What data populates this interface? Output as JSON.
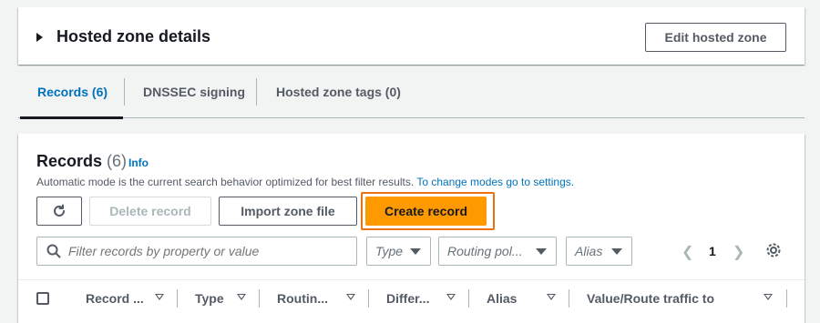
{
  "details": {
    "title": "Hosted zone details",
    "edit_label": "Edit hosted zone"
  },
  "tabs": [
    {
      "label": "Records (6)",
      "active": true
    },
    {
      "label": "DNSSEC signing",
      "active": false
    },
    {
      "label": "Hosted zone tags (0)",
      "active": false
    }
  ],
  "records": {
    "title": "Records",
    "count": "(6)",
    "info": "Info",
    "description": "Automatic mode is the current search behavior optimized for best filter results.",
    "settings_link": "To change modes go to settings.",
    "delete_label": "Delete record",
    "import_label": "Import zone file",
    "create_label": "Create record",
    "search_placeholder": "Filter records by property or value",
    "type_select": "Type",
    "routing_select": "Routing pol...",
    "alias_select": "Alias",
    "page": "1"
  },
  "columns": [
    "Record ...",
    "Type",
    "Routin...",
    "Differ...",
    "Alias",
    "Value/Route traffic to"
  ],
  "icons": {
    "refresh": "refresh-icon",
    "search": "search-icon",
    "settings": "gear-icon"
  },
  "colors": {
    "primary": "#ff9900",
    "highlight": "#ec7211",
    "link": "#0073bb"
  }
}
